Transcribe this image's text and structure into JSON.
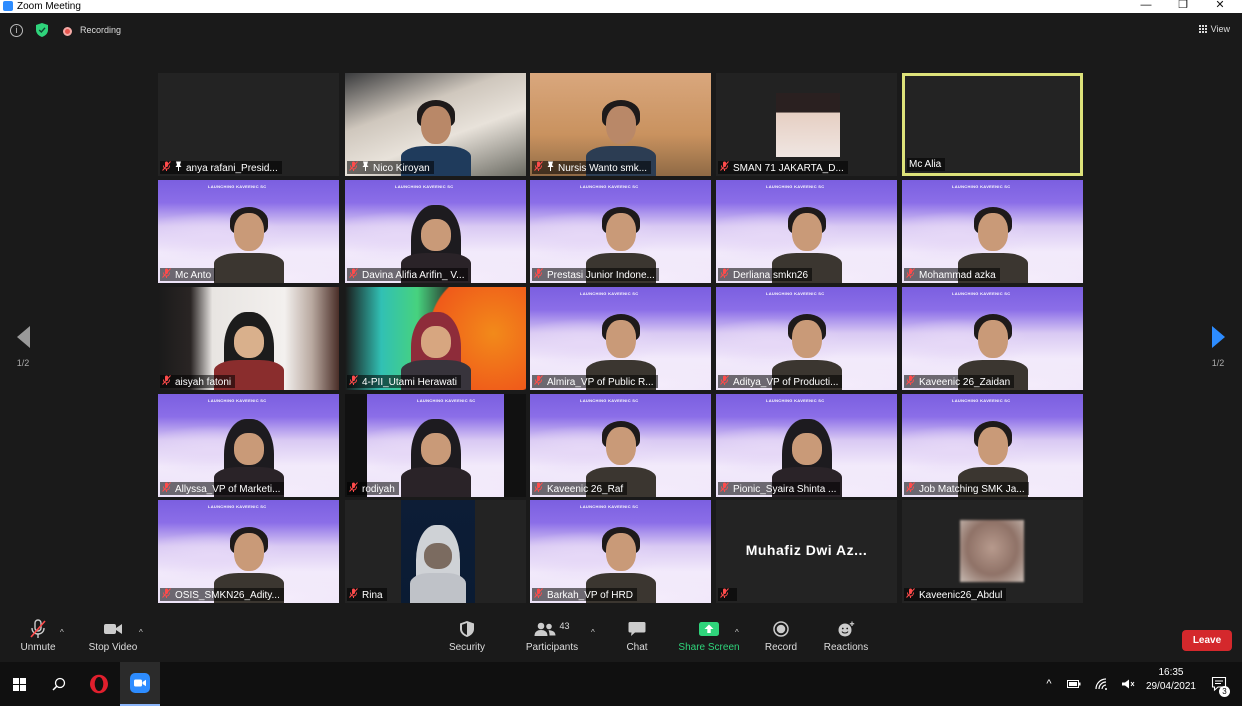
{
  "window": {
    "title": "Zoom Meeting"
  },
  "topbar": {
    "recording_label": "Recording",
    "view_label": "View"
  },
  "pager": {
    "left_label": "1/2",
    "right_label": "1/2"
  },
  "banner_text": "LAUNCHING KAVEENIC SC",
  "tiles": [
    {
      "name": "anya rafani_Presid...",
      "kind": "blank",
      "pinned": true
    },
    {
      "name": "Nico Kiroyan",
      "kind": "video-room",
      "pinned": true
    },
    {
      "name": "Nursis Wanto smk...",
      "kind": "video-room",
      "pinned": true
    },
    {
      "name": "SMAN 71 JAKARTA_D...",
      "kind": "photo"
    },
    {
      "name": "Mc Alia",
      "kind": "active-blank",
      "muted": false
    },
    {
      "name": "Mc Anto",
      "kind": "banner"
    },
    {
      "name": "Davina Alifia Arifin_ V...",
      "kind": "banner-hijab"
    },
    {
      "name": "Prestasi Junior Indone...",
      "kind": "banner"
    },
    {
      "name": "Derliana smkn26",
      "kind": "banner"
    },
    {
      "name": "Mohammad azka",
      "kind": "banner"
    },
    {
      "name": "aisyah fatoni",
      "kind": "room-hijab"
    },
    {
      "name": "4-PII_Utami Herawati",
      "kind": "orange-hijab"
    },
    {
      "name": "Almira_VP of Public R...",
      "kind": "banner"
    },
    {
      "name": "Aditya_VP of Producti...",
      "kind": "banner"
    },
    {
      "name": "Kaveenic 26_Zaidan",
      "kind": "banner"
    },
    {
      "name": "Allyssa_VP of Marketi...",
      "kind": "banner-hijab"
    },
    {
      "name": "rodiyah",
      "kind": "banner-hijab-narrow"
    },
    {
      "name": "Kaveenic 26_Raf",
      "kind": "banner"
    },
    {
      "name": "Pionic_Syaira Shinta ...",
      "kind": "banner-hijab"
    },
    {
      "name": "Job Matching SMK Ja...",
      "kind": "banner"
    },
    {
      "name": "OSIS_SMKN26_Adity...",
      "kind": "banner"
    },
    {
      "name": "Rina",
      "kind": "dark-hijab"
    },
    {
      "name": "Barkah_VP of HRD",
      "kind": "banner"
    },
    {
      "name": "",
      "kind": "name-only",
      "big_name": "Muhafiz Dwi Az..."
    },
    {
      "name": "Kaveenic26_Abdul",
      "kind": "blur-photo"
    }
  ],
  "toolbar": {
    "unmute": "Unmute",
    "stop_video": "Stop Video",
    "security": "Security",
    "participants": "Participants",
    "participants_count": "43",
    "chat": "Chat",
    "share_screen": "Share Screen",
    "record": "Record",
    "reactions": "Reactions",
    "leave": "Leave"
  },
  "taskbar": {
    "time": "16:35",
    "date": "29/04/2021",
    "notifications": "3"
  },
  "colors": {
    "accent": "#2d8cff",
    "leave": "#d4282c",
    "share": "#2fd47b",
    "active_speaker": "#dde27a",
    "muted": "#ff4b4b"
  }
}
